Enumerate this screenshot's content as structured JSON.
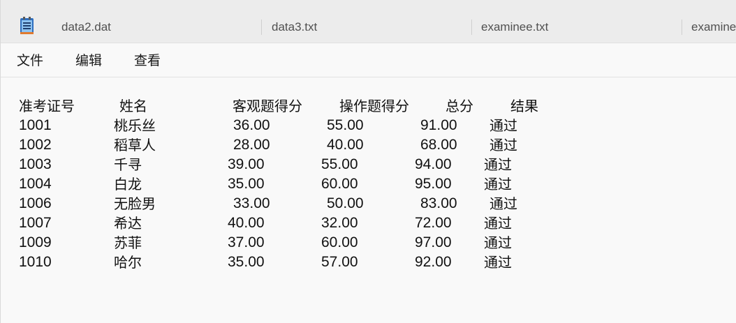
{
  "window": {
    "app_icon": "notepad-icon"
  },
  "tabs": [
    {
      "label": "data2.dat"
    },
    {
      "label": "data3.txt"
    },
    {
      "label": "examinee.txt"
    },
    {
      "label": "examine"
    }
  ],
  "menu": {
    "file": "文件",
    "edit": "编辑",
    "view": "查看"
  },
  "document": {
    "header": {
      "id": "准考证号",
      "name": "姓名",
      "objective": "客观题得分",
      "operation": "操作题得分",
      "total": "总分",
      "result": "结果"
    },
    "rows": [
      {
        "id": "1001",
        "name": "桃乐丝",
        "objective": "36.00",
        "operation": "55.00",
        "total": "91.00",
        "result": "通过"
      },
      {
        "id": "1002",
        "name": "稻草人",
        "objective": "28.00",
        "operation": "40.00",
        "total": "68.00",
        "result": "通过"
      },
      {
        "id": "1003",
        "name": "千寻",
        "objective": "39.00",
        "operation": "55.00",
        "total": "94.00",
        "result": "通过"
      },
      {
        "id": "1004",
        "name": "白龙",
        "objective": "35.00",
        "operation": "60.00",
        "total": "95.00",
        "result": "通过"
      },
      {
        "id": "1006",
        "name": "无脸男",
        "objective": "33.00",
        "operation": "50.00",
        "total": "83.00",
        "result": "通过"
      },
      {
        "id": "1007",
        "name": "希达",
        "objective": "40.00",
        "operation": "32.00",
        "total": "72.00",
        "result": "通过"
      },
      {
        "id": "1009",
        "name": "苏菲",
        "objective": "37.00",
        "operation": "60.00",
        "total": "97.00",
        "result": "通过"
      },
      {
        "id": "1010",
        "name": "哈尔",
        "objective": "35.00",
        "operation": "57.00",
        "total": "92.00",
        "result": "通过"
      }
    ]
  }
}
